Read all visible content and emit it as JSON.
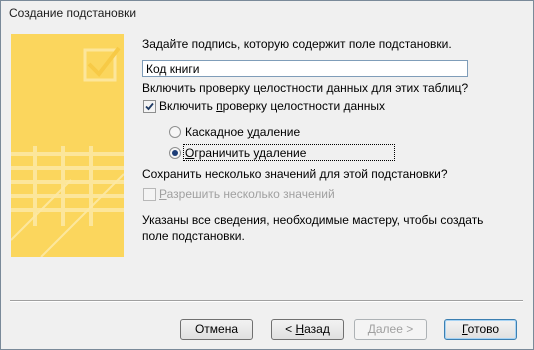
{
  "window": {
    "title": "Создание подстановки"
  },
  "prompt": "Задайте подпись, которую содержит поле подстановки.",
  "caption_field": {
    "value": "Код книги"
  },
  "integrity_question": "Включить проверку целостности данных для этих таблиц?",
  "integrity_checkbox": {
    "pre": "Включить ",
    "accel": "п",
    "post": "роверку целостности данных",
    "checked": true
  },
  "radio_cascade": {
    "pre": "Каскадное ",
    "accel": "у",
    "post": "даление",
    "selected": false
  },
  "radio_restrict": {
    "accel": "О",
    "post": "граничить удаление",
    "selected": true
  },
  "multi_question": "Сохранить несколько значений для этой подстановки?",
  "multi_checkbox": {
    "accel": "Р",
    "post": "азрешить несколько значений",
    "checked": false,
    "disabled": true
  },
  "info_line1": "Указаны все сведения, необходимые мастеру, чтобы создать",
  "info_line2": "поле подстановки.",
  "buttons": {
    "cancel": "Отмена",
    "back_prefix": "< ",
    "back_accel": "Н",
    "back_rest": "азад",
    "next": "Далее >",
    "finish_accel": "Г",
    "finish_rest": "отово"
  },
  "colors": {
    "sidebar": "#fbd65d",
    "sidebar_decor": "#fde9a6",
    "background": "#f0f0f0"
  }
}
